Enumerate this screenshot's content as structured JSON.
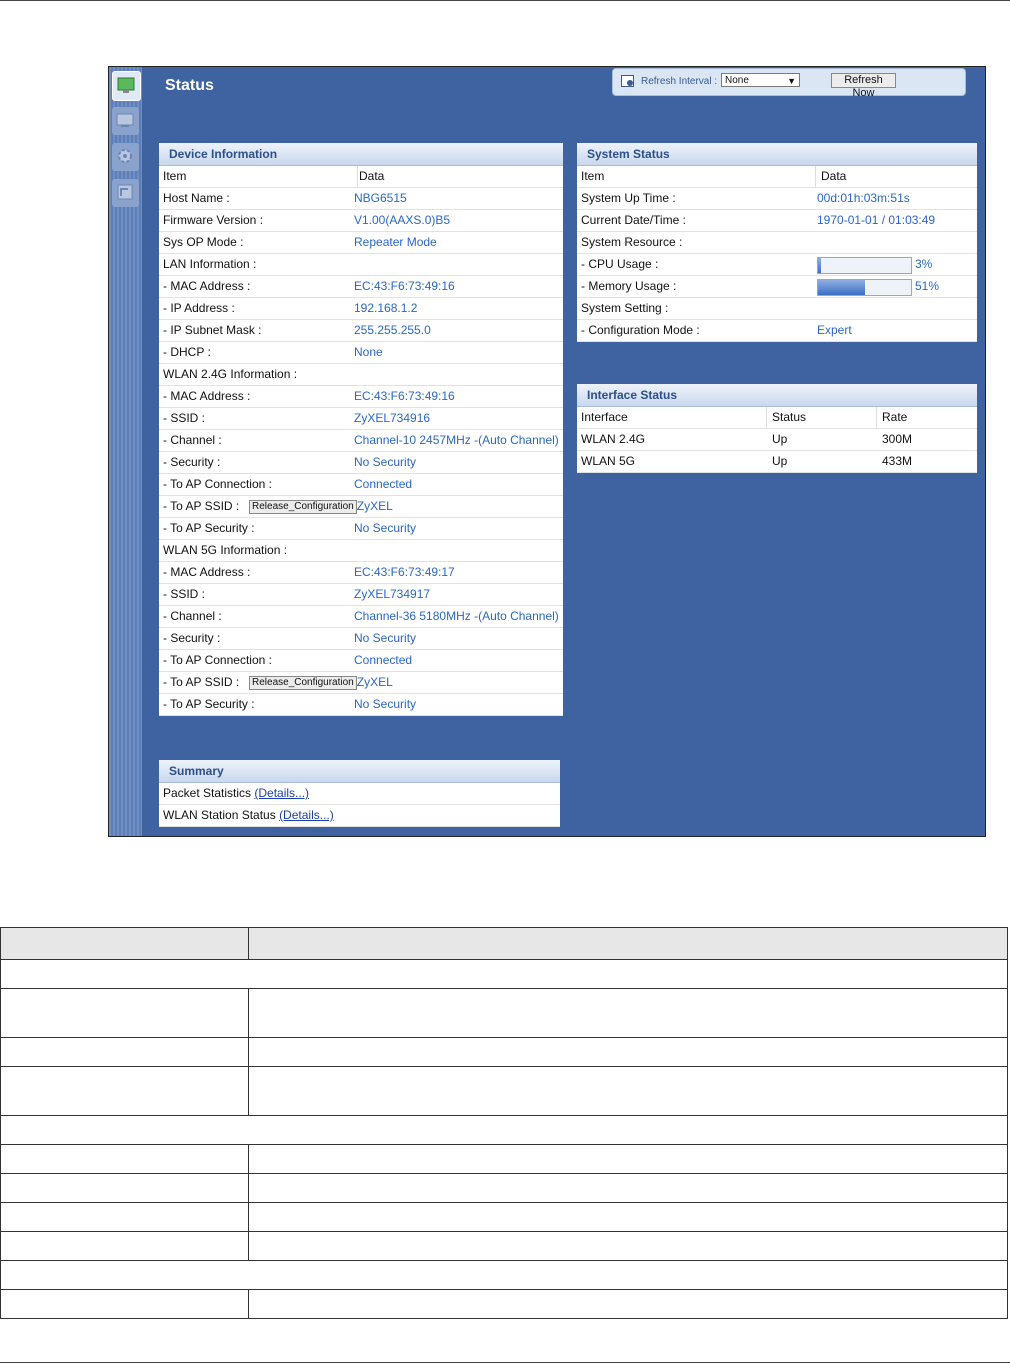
{
  "page_title": "Status",
  "refresh": {
    "label": "Refresh Interval :",
    "interval_value": "None",
    "refresh_now_label": "Refresh Now"
  },
  "sidebar": {
    "items": [
      {
        "icon": "dashboard-icon",
        "active": true
      },
      {
        "icon": "monitor-icon",
        "active": false
      },
      {
        "icon": "gear-icon",
        "active": false
      },
      {
        "icon": "maintenance-icon",
        "active": false
      }
    ]
  },
  "device_info": {
    "title": "Device Information",
    "col_item": "Item",
    "col_data": "Data",
    "rows": [
      {
        "item": "Host Name :",
        "data": "NBG6515"
      },
      {
        "item": "Firmware Version :",
        "data": "V1.00(AAXS.0)B5"
      },
      {
        "item": "Sys OP Mode :",
        "data": "Repeater Mode"
      },
      {
        "item": "LAN Information :",
        "data": ""
      },
      {
        "item": " - MAC Address :",
        "data": "EC:43:F6:73:49:16"
      },
      {
        "item": " - IP Address :",
        "data": "192.168.1.2"
      },
      {
        "item": " - IP Subnet Mask :",
        "data": "255.255.255.0"
      },
      {
        "item": " - DHCP :",
        "data": "None"
      },
      {
        "item": "WLAN 2.4G Information :",
        "data": ""
      },
      {
        "item": " - MAC Address :",
        "data": "EC:43:F6:73:49:16"
      },
      {
        "item": " - SSID :",
        "data": "ZyXEL734916"
      },
      {
        "item": " - Channel :",
        "data": "Channel-10 2457MHz -(Auto Channel)"
      },
      {
        "item": " - Security :",
        "data": "No Security"
      },
      {
        "item": " - To AP Connection :",
        "data": "Connected"
      },
      {
        "item": " - To AP SSID :",
        "data": "ZyXEL",
        "button": "Release_Configuration"
      },
      {
        "item": " - To AP Security :",
        "data": "No Security"
      },
      {
        "item": "WLAN 5G Information :",
        "data": ""
      },
      {
        "item": " - MAC Address :",
        "data": "EC:43:F6:73:49:17"
      },
      {
        "item": " - SSID :",
        "data": "ZyXEL734917"
      },
      {
        "item": " - Channel :",
        "data": "Channel-36 5180MHz -(Auto Channel)"
      },
      {
        "item": " - Security :",
        "data": "No Security"
      },
      {
        "item": " - To AP Connection :",
        "data": "Connected"
      },
      {
        "item": " - To AP SSID :",
        "data": "ZyXEL",
        "button": "Release_Configuration"
      },
      {
        "item": " - To AP Security :",
        "data": "No Security"
      }
    ]
  },
  "system_status": {
    "title": "System Status",
    "col_item": "Item",
    "col_data": "Data",
    "rows": [
      {
        "item": "System Up Time :",
        "data": "00d:01h:03m:51s"
      },
      {
        "item": "Current Date/Time :",
        "data": "1970-01-01 / 01:03:49"
      },
      {
        "item": "System Resource :",
        "data": ""
      },
      {
        "item": " - CPU Usage :",
        "data": "3%",
        "usage": 0.03
      },
      {
        "item": " - Memory Usage :",
        "data": "51%",
        "usage": 0.51
      },
      {
        "item": "System Setting :",
        "data": ""
      },
      {
        "item": " - Configuration Mode :",
        "data": "Expert"
      }
    ]
  },
  "interface_status": {
    "title": "Interface Status",
    "columns": [
      "Interface",
      "Status",
      "Rate"
    ],
    "rows": [
      [
        "WLAN 2.4G",
        "Up",
        "300M"
      ],
      [
        "WLAN 5G",
        "Up",
        "433M"
      ]
    ]
  },
  "summary": {
    "title": "Summary",
    "rows": [
      {
        "label": "Packet Statistics",
        "link": "(Details...)"
      },
      {
        "label": "WLAN Station Status",
        "link": "(Details...)"
      }
    ]
  }
}
